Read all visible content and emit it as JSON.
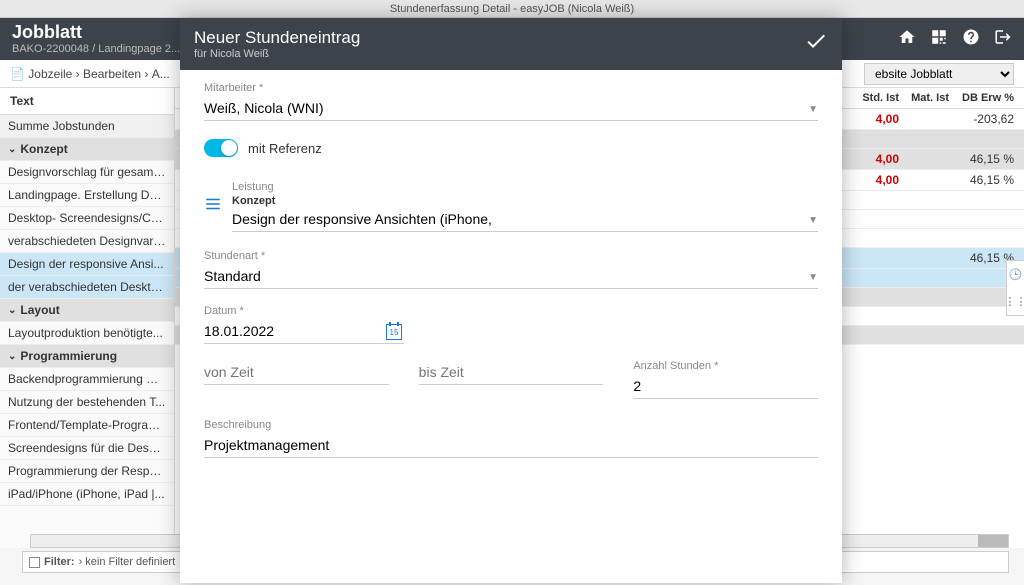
{
  "titlebar": "Stundenerfassung Detail - easyJOB (Nicola Weiß)",
  "header": {
    "title": "Jobblatt",
    "subtitle": "BAKO-2200048 / Landingpage 2..."
  },
  "breadcrumb": {
    "icon_tip": "Jobzeile",
    "item1": "Jobzeile",
    "sep1": "›",
    "item2": "Bearbeiten",
    "sep2": "›",
    "item3": "A...",
    "select_label": "ebsite Jobblatt"
  },
  "left": {
    "header": "Text",
    "rows": [
      {
        "label": "Summe Jobstunden",
        "type": "sum"
      },
      {
        "label": "Konzept",
        "type": "group"
      },
      {
        "label": "Designvorschlag für gesamt...",
        "type": "text"
      },
      {
        "label": "Landingpage. Erstellung De...",
        "type": "text"
      },
      {
        "label": "Desktop- Screendesigns/Co...",
        "type": "text"
      },
      {
        "label": "verabschiedeten Designvari...",
        "type": "text"
      },
      {
        "label": "Design der responsive Ansi...",
        "type": "highlighted"
      },
      {
        "label": "der verabschiedeten Deskto...",
        "type": "highlighted"
      },
      {
        "label": "Layout",
        "type": "group"
      },
      {
        "label": "Layoutproduktion benötigte...",
        "type": "text"
      },
      {
        "label": "Programmierung",
        "type": "group"
      },
      {
        "label": "Backendprogrammierung W...",
        "type": "text"
      },
      {
        "label": "Nutzung der bestehenden T...",
        "type": "text"
      },
      {
        "label": "Frontend/Template-Program...",
        "type": "text"
      },
      {
        "label": "Screendesigns für die Deskt...",
        "type": "text"
      },
      {
        "label": "Programmierung der Respo...",
        "type": "text"
      },
      {
        "label": "iPad/iPhone (iPhone, iPad |...",
        "type": "text"
      }
    ]
  },
  "right": {
    "cols": {
      "std": "Std. Ist",
      "mat": "Mat. Ist",
      "db": "DB Erw %"
    },
    "rows": [
      {
        "std": "4,00",
        "mat": "",
        "db": "-203,62",
        "style": ""
      },
      {
        "std": "",
        "mat": "",
        "db": "",
        "style": "gray"
      },
      {
        "std": "4,00",
        "mat": "",
        "db": "46,15 %",
        "style": "gray"
      },
      {
        "std": "4,00",
        "mat": "",
        "db": "46,15 %",
        "style": ""
      },
      {
        "std": "",
        "mat": "",
        "db": "",
        "style": ""
      },
      {
        "std": "",
        "mat": "",
        "db": "",
        "style": ""
      },
      {
        "std": "",
        "mat": "",
        "db": "",
        "style": ""
      },
      {
        "std": "",
        "mat": "",
        "db": "46,15 %",
        "style": "blue"
      },
      {
        "std": "",
        "mat": "",
        "db": "",
        "style": "blue"
      },
      {
        "std": "",
        "mat": "",
        "db": "",
        "style": "gray"
      },
      {
        "std": "",
        "mat": "",
        "db": "",
        "style": ""
      },
      {
        "std": "",
        "mat": "",
        "db": "",
        "style": "gray"
      }
    ]
  },
  "filter": {
    "label": "Filter:",
    "text": "› kein Filter definiert"
  },
  "modal": {
    "title": "Neuer Stundeneintrag",
    "subtitle": "für Nicola Weiß",
    "employee_label": "Mitarbeiter *",
    "employee_value": "Weiß, Nicola (WNI)",
    "toggle_label": "mit Referenz",
    "service_label": "Leistung",
    "service_cat": "Konzept",
    "service_value": "Design der responsive Ansichten (iPhone,",
    "hourtype_label": "Stundenart *",
    "hourtype_value": "Standard",
    "date_label": "Datum *",
    "date_value": "18.01.2022",
    "cal_day": "15",
    "from_label": "von Zeit",
    "from_value": "",
    "to_label": "bis Zeit",
    "to_value": "",
    "hours_label": "Anzahl Stunden *",
    "hours_value": "2",
    "desc_label": "Beschreibung",
    "desc_value": "Projektmanagement"
  }
}
